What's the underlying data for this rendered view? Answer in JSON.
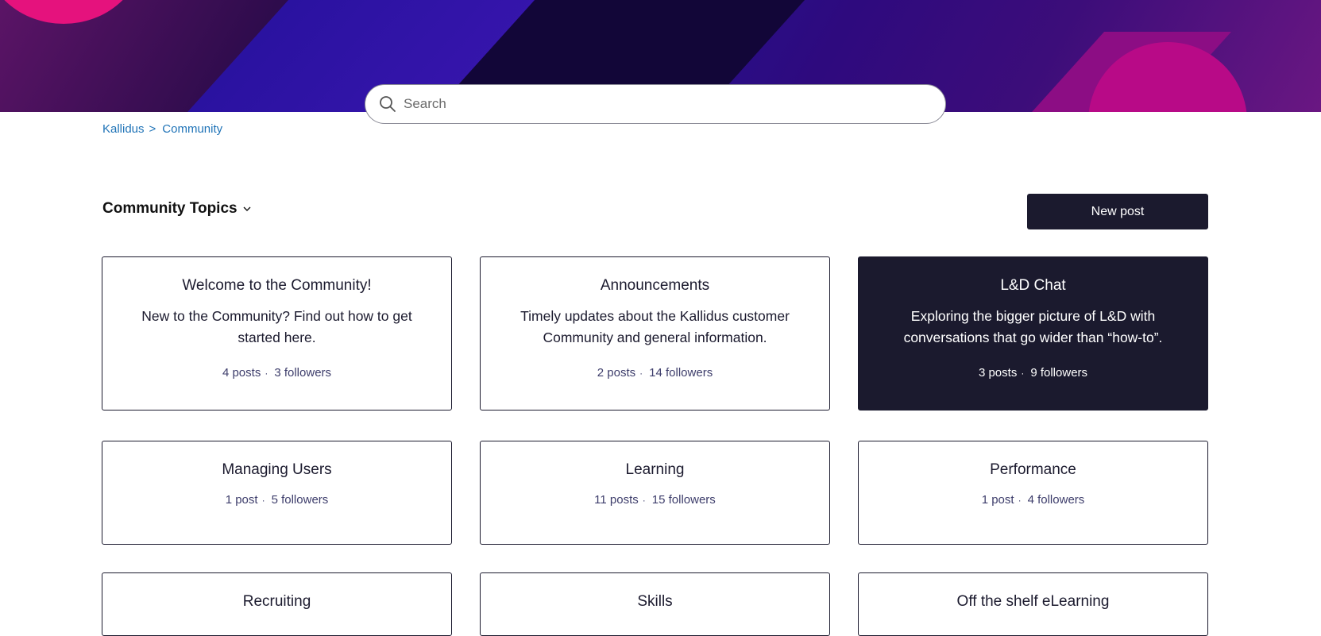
{
  "search": {
    "placeholder": "Search"
  },
  "breadcrumb": {
    "items": [
      "Kallidus",
      "Community"
    ],
    "separator": ">"
  },
  "topics_header": {
    "label": "Community Topics"
  },
  "new_post_label": "New post",
  "cards": [
    {
      "title": "Welcome to the Community!",
      "description": "New to the Community? Find out how to get started here.",
      "posts": "4 posts",
      "followers": "3 followers"
    },
    {
      "title": "Announcements",
      "description": "Timely updates about the Kallidus customer Community and general information.",
      "posts": "2 posts",
      "followers": "14 followers"
    },
    {
      "title": "L&D Chat",
      "description": "Exploring the bigger picture of L&D with conversations that go wider than “how-to”.",
      "posts": "3 posts",
      "followers": "9 followers"
    },
    {
      "title": "Managing Users",
      "posts": "1 post",
      "followers": "5 followers"
    },
    {
      "title": "Learning",
      "posts": "11 posts",
      "followers": "15 followers"
    },
    {
      "title": "Performance",
      "posts": "1 post",
      "followers": "4 followers"
    },
    {
      "title": "Recruiting"
    },
    {
      "title": "Skills"
    },
    {
      "title": "Off the shelf eLearning"
    }
  ],
  "colors": {
    "dark": "#1b1a2e",
    "link": "#1f73b7",
    "accent_pink": "#e5127d"
  }
}
